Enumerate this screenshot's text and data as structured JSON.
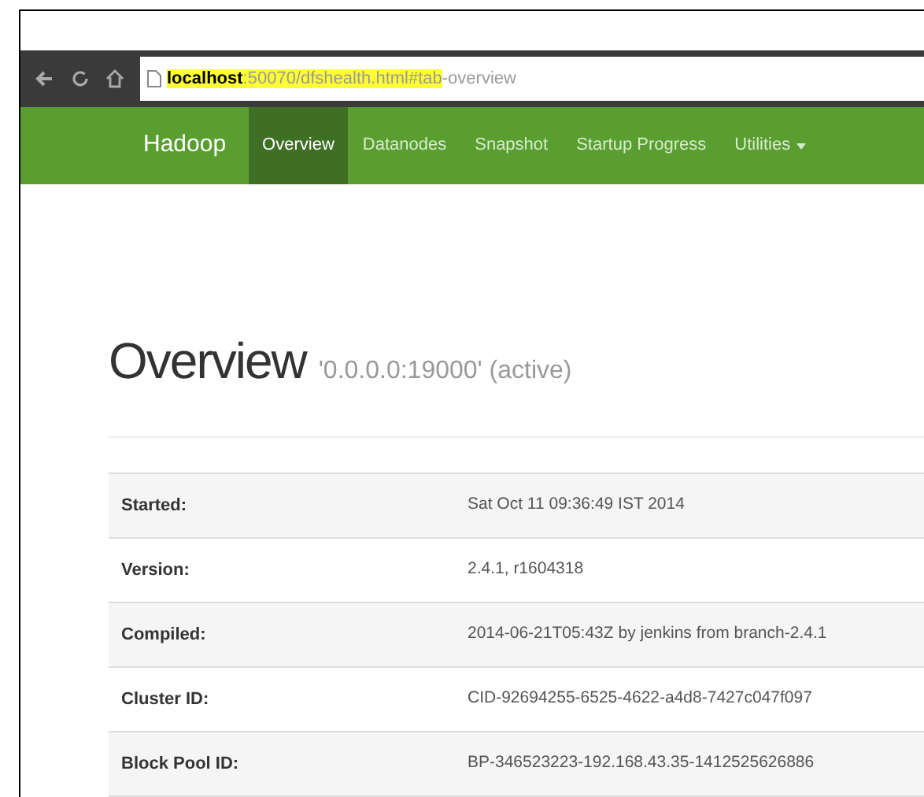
{
  "browser": {
    "url_parts": [
      {
        "text": "localhost",
        "bold": true,
        "highlighted": true
      },
      {
        "text": ":50070/dfshealth.html#tab",
        "bold": false,
        "highlighted": true
      },
      {
        "text": "-overview",
        "bold": false,
        "highlighted": false
      }
    ]
  },
  "navbar": {
    "brand": "Hadoop",
    "items": [
      {
        "label": "Overview",
        "selected": true
      },
      {
        "label": "Datanodes",
        "selected": false
      },
      {
        "label": "Snapshot",
        "selected": false
      },
      {
        "label": "Startup Progress",
        "selected": false
      },
      {
        "label": "Utilities",
        "selected": false,
        "dropdown": true
      }
    ]
  },
  "heading": {
    "title": "Overview",
    "subtitle": "'0.0.0.0:19000' (active)"
  },
  "table": {
    "rows": [
      {
        "label": "Started:",
        "value": "Sat Oct 11 09:36:49 IST 2014"
      },
      {
        "label": "Version:",
        "value": "2.4.1, r1604318"
      },
      {
        "label": "Compiled:",
        "value": "2014-06-21T05:43Z by jenkins from branch-2.4.1"
      },
      {
        "label": "Cluster ID:",
        "value": "CID-92694255-6525-4622-a4d8-7427c047f097"
      },
      {
        "label": "Block Pool ID:",
        "value": "BP-346523223-192.168.43.35-1412525626886"
      }
    ]
  }
}
